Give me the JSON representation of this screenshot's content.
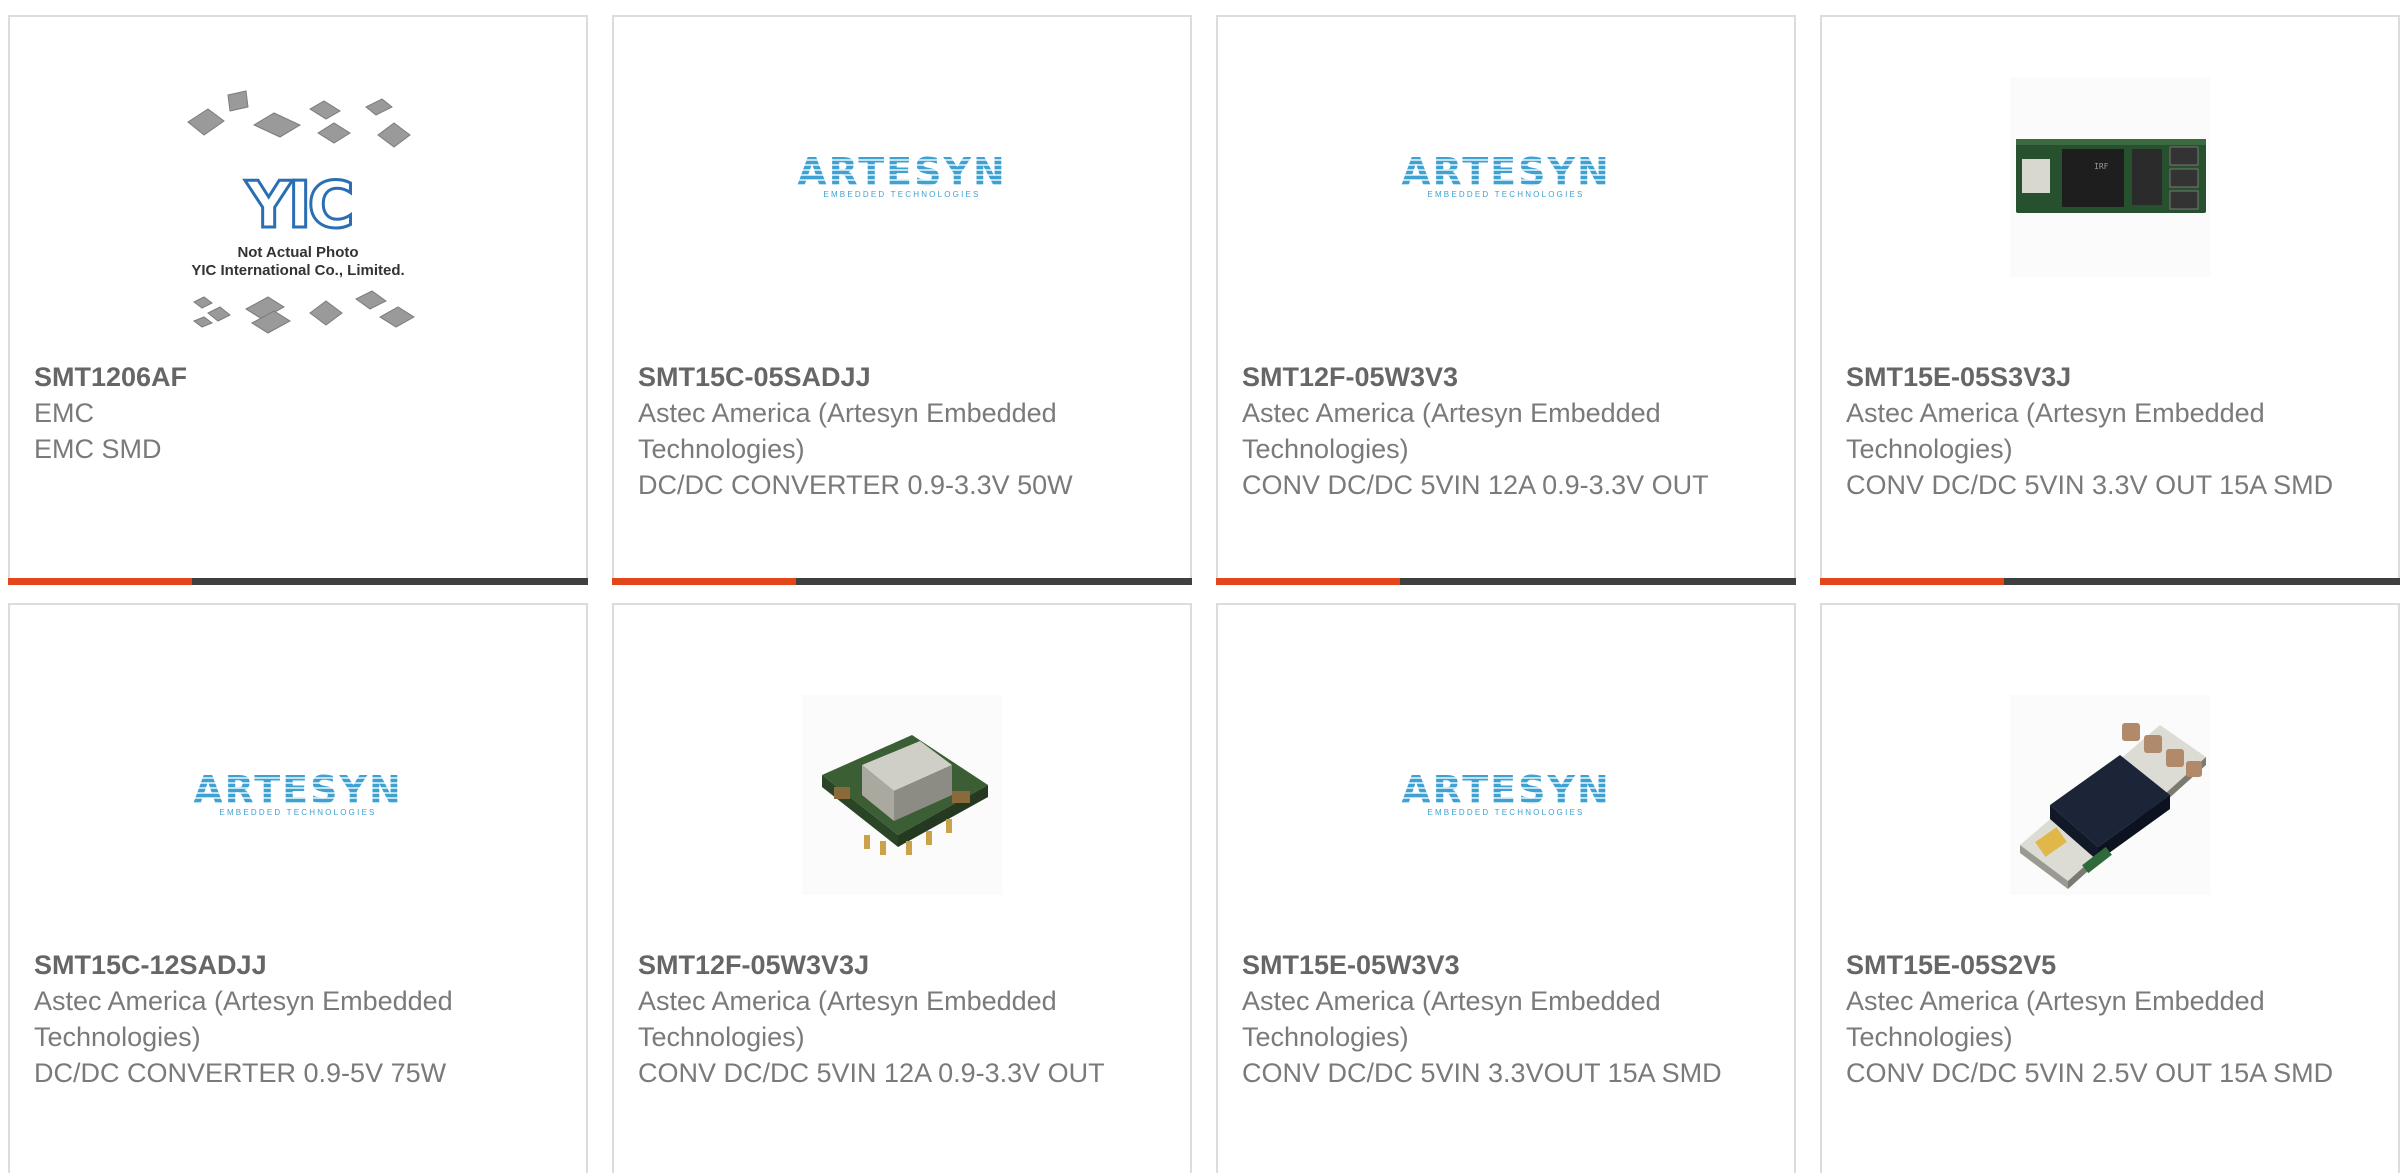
{
  "products": [
    {
      "part_number": "SMT1206AF",
      "manufacturer": "EMC",
      "description": "EMC SMD",
      "image": "not-actual-photo",
      "image_caption": [
        "Not Actual Photo",
        "YIC International Co., Limited."
      ]
    },
    {
      "part_number": "SMT15C-05SADJJ",
      "manufacturer": "Astec America (Artesyn Embedded Technologies)",
      "description": "DC/DC CONVERTER 0.9-3.3V 50W",
      "image": "artesyn-logo"
    },
    {
      "part_number": "SMT12F-05W3V3",
      "manufacturer": "Astec America (Artesyn Embedded Technologies)",
      "description": "CONV DC/DC 5VIN 12A 0.9-3.3V OUT",
      "image": "artesyn-logo"
    },
    {
      "part_number": "SMT15E-05S3V3J",
      "manufacturer": "Astec America (Artesyn Embedded Technologies)",
      "description": "CONV DC/DC 5VIN 3.3V OUT 15A SMD",
      "image": "pcb-module-photo"
    },
    {
      "part_number": "SMT15C-12SADJJ",
      "manufacturer": "Astec America (Artesyn Embedded Technologies)",
      "description": "DC/DC CONVERTER 0.9-5V 75W",
      "image": "artesyn-logo"
    },
    {
      "part_number": "SMT12F-05W3V3J",
      "manufacturer": "Astec America (Artesyn Embedded Technologies)",
      "description": "CONV DC/DC 5VIN 12A 0.9-3.3V OUT",
      "image": "smd-module-photo"
    },
    {
      "part_number": "SMT15E-05W3V3",
      "manufacturer": "Astec America (Artesyn Embedded Technologies)",
      "description": "CONV DC/DC 5VIN 3.3VOUT 15A SMD",
      "image": "artesyn-logo"
    },
    {
      "part_number": "SMT15E-05S2V5",
      "manufacturer": "Astec America (Artesyn Embedded Technologies)",
      "description": "CONV DC/DC 5VIN 2.5V OUT 15A SMD",
      "image": "pcb-module-photo-2"
    }
  ],
  "artesyn_logo": {
    "word": "ARTESYN",
    "tagline": "EMBEDDED TECHNOLOGIES"
  },
  "yic_logo": {
    "text": "YIC"
  },
  "colors": {
    "accent": "#e4461c",
    "bar": "#3f3f3f",
    "text": "#7a7a7a",
    "border": "#dcdcdc",
    "artesyn_blue": "#3fa1d2"
  }
}
